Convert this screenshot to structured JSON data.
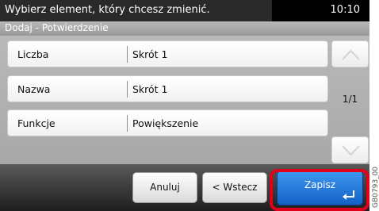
{
  "message_bar": {
    "text": "Wybierz element, który chcesz zmienić.",
    "time": "10:10"
  },
  "title": "Dodaj - Potwierdzenie",
  "rows": [
    {
      "label": "Liczba",
      "value": "Skrót 1"
    },
    {
      "label": "Nazwa",
      "value": "Skrót 1"
    },
    {
      "label": "Funkcje",
      "value": "Powiększenie"
    }
  ],
  "page_indicator": "1/1",
  "buttons": {
    "cancel": "Anuluj",
    "back": "< Wstecz",
    "save": "Zapisz"
  },
  "image_code": "GB0793_00",
  "colors": {
    "highlight": "#e0001b",
    "save_button": "#1f74d8"
  },
  "icons": {
    "scroll_up": "chevron-up-icon",
    "scroll_down": "chevron-down-icon",
    "save": "enter-icon"
  }
}
